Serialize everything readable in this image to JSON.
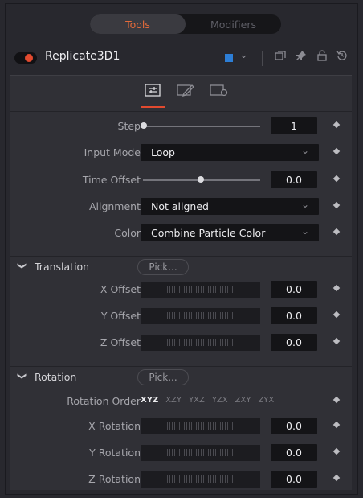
{
  "top_tabs": [
    "Tools",
    "Modifiers"
  ],
  "header": {
    "tool_name": "Replicate3D1",
    "color_swatch": "#2d7ed6"
  },
  "rows": {
    "step": {
      "label": "Step",
      "value": "1"
    },
    "input_mode": {
      "label": "Input Mode",
      "value": "Loop"
    },
    "time_offset": {
      "label": "Time Offset",
      "value": "0.0"
    },
    "alignment": {
      "label": "Alignment",
      "value": "Not aligned"
    },
    "color": {
      "label": "Color",
      "value": "Combine Particle Color"
    }
  },
  "translation": {
    "title": "Translation",
    "pick": "Pick...",
    "x": {
      "label": "X Offset",
      "value": "0.0"
    },
    "y": {
      "label": "Y Offset",
      "value": "0.0"
    },
    "z": {
      "label": "Z Offset",
      "value": "0.0"
    }
  },
  "rotation": {
    "title": "Rotation",
    "pick": "Pick...",
    "order_label": "Rotation Order",
    "orders": [
      "XYZ",
      "XZY",
      "YXZ",
      "YZX",
      "ZXY",
      "ZYX"
    ],
    "x": {
      "label": "X Rotation",
      "value": "0.0"
    },
    "y": {
      "label": "Y Rotation",
      "value": "0.0"
    },
    "z": {
      "label": "Z Rotation",
      "value": "0.0"
    }
  },
  "colors": {
    "accent": "#e24a2f",
    "tab_active_text": "#e36a3a"
  }
}
